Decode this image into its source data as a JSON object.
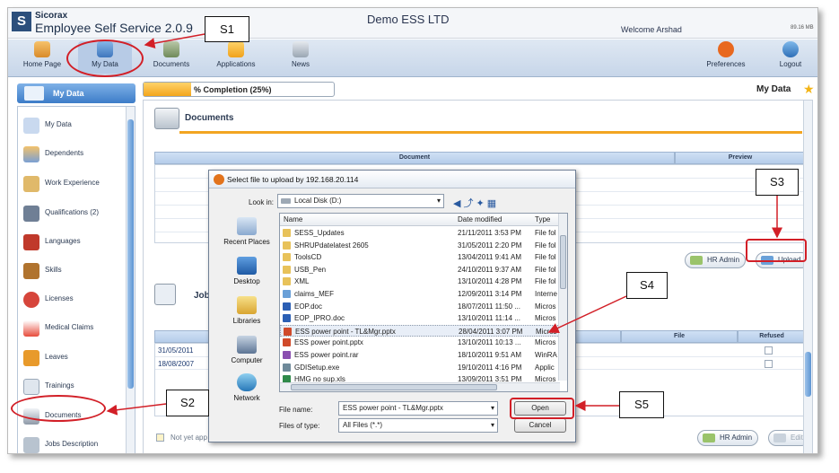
{
  "header": {
    "brand": "Sicorax",
    "product": "Employee Self Service 2.0.9",
    "company": "Demo ESS LTD",
    "welcome": "Welcome Arshad",
    "storage": "89.16 MB"
  },
  "nav": {
    "items": [
      "Home Page",
      "My Data",
      "Documents",
      "Applications",
      "News"
    ],
    "right_items": [
      "Preferences",
      "Logout"
    ]
  },
  "sidebar": {
    "title": "My Data",
    "items": [
      "My Data",
      "Dependents",
      "Work Experience",
      "Qualifications (2)",
      "Languages",
      "Skills",
      "Licenses",
      "Medical Claims",
      "Leaves",
      "Trainings",
      "Documents",
      "Jobs Description"
    ]
  },
  "main": {
    "progress_label": "% Completion (25%)",
    "progress_value": 0.25,
    "page_title": "My Data",
    "documents_section_title": "Documents",
    "doc_table_headers": [
      "Document",
      "Preview"
    ],
    "jobs_section_title": "Jobs",
    "jobs_table_headers": [
      "File",
      "Refused"
    ],
    "jobs_dates": [
      "31/05/2011",
      "18/08/2007"
    ],
    "legend_text": "Not yet app",
    "buttons": {
      "hr_admin": "HR Admin",
      "upload": "Upload",
      "hr_admin_2": "HR Admin",
      "edit": "Edit"
    }
  },
  "dialog": {
    "title": "Select file to upload by 192.168.20.114",
    "look_in_label": "Look in:",
    "look_in_value": "Local Disk (D:)",
    "places": [
      "Recent Places",
      "Desktop",
      "Libraries",
      "Computer",
      "Network"
    ],
    "columns": [
      "Name",
      "Date modified",
      "Type"
    ],
    "files": [
      {
        "name": "SESS_Updates",
        "date": "21/11/2011 3:53 PM",
        "type": "File fol",
        "kind": "folder"
      },
      {
        "name": "SHRUPdatelatest 2605",
        "date": "31/05/2011 2:20 PM",
        "type": "File fol",
        "kind": "folder"
      },
      {
        "name": "ToolsCD",
        "date": "13/04/2011 9:41 AM",
        "type": "File fol",
        "kind": "folder"
      },
      {
        "name": "USB_Pen",
        "date": "24/10/2011 9:37 AM",
        "type": "File fol",
        "kind": "folder"
      },
      {
        "name": "XML",
        "date": "13/10/2011 4:28 PM",
        "type": "File fol",
        "kind": "folder"
      },
      {
        "name": "claims_MEF",
        "date": "12/09/2011 3:14 PM",
        "type": "Interne",
        "kind": "web"
      },
      {
        "name": "EOP.doc",
        "date": "18/07/2011 11:50 ...",
        "type": "Micros",
        "kind": "doc"
      },
      {
        "name": "EOP_IPRO.doc",
        "date": "13/10/2011 11:14 ...",
        "type": "Micros",
        "kind": "doc"
      },
      {
        "name": "ESS power point - TL&Mgr.pptx",
        "date": "28/04/2011 3:07 PM",
        "type": "Micros",
        "kind": "ppt"
      },
      {
        "name": "ESS power point.pptx",
        "date": "13/10/2011 10:13 ...",
        "type": "Micros",
        "kind": "ppt"
      },
      {
        "name": "ESS power point.rar",
        "date": "18/10/2011 9:51 AM",
        "type": "WinRA",
        "kind": "rar"
      },
      {
        "name": "GDISetup.exe",
        "date": "19/10/2011 4:16 PM",
        "type": "Applic",
        "kind": "exe"
      },
      {
        "name": "HMG no sup.xls",
        "date": "13/09/2011 3:51 PM",
        "type": "Micros",
        "kind": "xls"
      }
    ],
    "file_name_label": "File name:",
    "file_name_value": "ESS power point - TL&Mgr.pptx",
    "file_type_label": "Files of type:",
    "file_type_value": "All Files (*.*)",
    "open_label": "Open",
    "cancel_label": "Cancel"
  },
  "annotations": [
    "S1",
    "S2",
    "S3",
    "S4",
    "S5"
  ],
  "colors": {
    "accent_orange": "#f2a522",
    "annotation_red": "#d21f27",
    "brand_blue": "#2c4f7c"
  }
}
